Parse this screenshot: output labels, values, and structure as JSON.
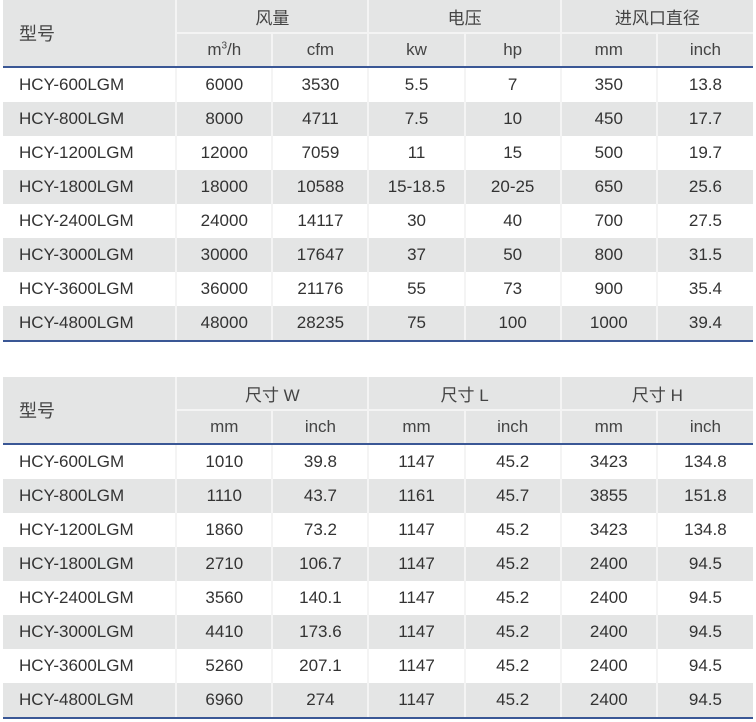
{
  "table1": {
    "model_header": "型号",
    "groups": [
      "风量",
      "电压",
      "进风口直径"
    ],
    "units": [
      "m3/h",
      "cfm",
      "kw",
      "hp",
      "mm",
      "inch"
    ],
    "rows": [
      [
        "HCY-600LGM",
        "6000",
        "3530",
        "5.5",
        "7",
        "350",
        "13.8"
      ],
      [
        "HCY-800LGM",
        "8000",
        "4711",
        "7.5",
        "10",
        "450",
        "17.7"
      ],
      [
        "HCY-1200LGM",
        "12000",
        "7059",
        "11",
        "15",
        "500",
        "19.7"
      ],
      [
        "HCY-1800LGM",
        "18000",
        "10588",
        "15-18.5",
        "20-25",
        "650",
        "25.6"
      ],
      [
        "HCY-2400LGM",
        "24000",
        "14117",
        "30",
        "40",
        "700",
        "27.5"
      ],
      [
        "HCY-3000LGM",
        "30000",
        "17647",
        "37",
        "50",
        "800",
        "31.5"
      ],
      [
        "HCY-3600LGM",
        "36000",
        "21176",
        "55",
        "73",
        "900",
        "35.4"
      ],
      [
        "HCY-4800LGM",
        "48000",
        "28235",
        "75",
        "100",
        "1000",
        "39.4"
      ]
    ]
  },
  "table2": {
    "model_header": "型号",
    "groups": [
      "尺寸 W",
      "尺寸 L",
      "尺寸 H"
    ],
    "units": [
      "mm",
      "inch",
      "mm",
      "inch",
      "mm",
      "inch"
    ],
    "rows": [
      [
        "HCY-600LGM",
        "1010",
        "39.8",
        "1147",
        "45.2",
        "3423",
        "134.8"
      ],
      [
        "HCY-800LGM",
        "1110",
        "43.7",
        "1161",
        "45.7",
        "3855",
        "151.8"
      ],
      [
        "HCY-1200LGM",
        "1860",
        "73.2",
        "1147",
        "45.2",
        "3423",
        "134.8"
      ],
      [
        "HCY-1800LGM",
        "2710",
        "106.7",
        "1147",
        "45.2",
        "2400",
        "94.5"
      ],
      [
        "HCY-2400LGM",
        "3560",
        "140.1",
        "1147",
        "45.2",
        "2400",
        "94.5"
      ],
      [
        "HCY-3000LGM",
        "4410",
        "173.6",
        "1147",
        "45.2",
        "2400",
        "94.5"
      ],
      [
        "HCY-3600LGM",
        "5260",
        "207.1",
        "1147",
        "45.2",
        "2400",
        "94.5"
      ],
      [
        "HCY-4800LGM",
        "6960",
        "274",
        "1147",
        "45.2",
        "2400",
        "94.5"
      ]
    ]
  },
  "colors": {
    "header_bg": "#e4e5e5",
    "stripe_bg": "#e4e5e5",
    "rule": "#3a5795",
    "text": "#333333"
  }
}
